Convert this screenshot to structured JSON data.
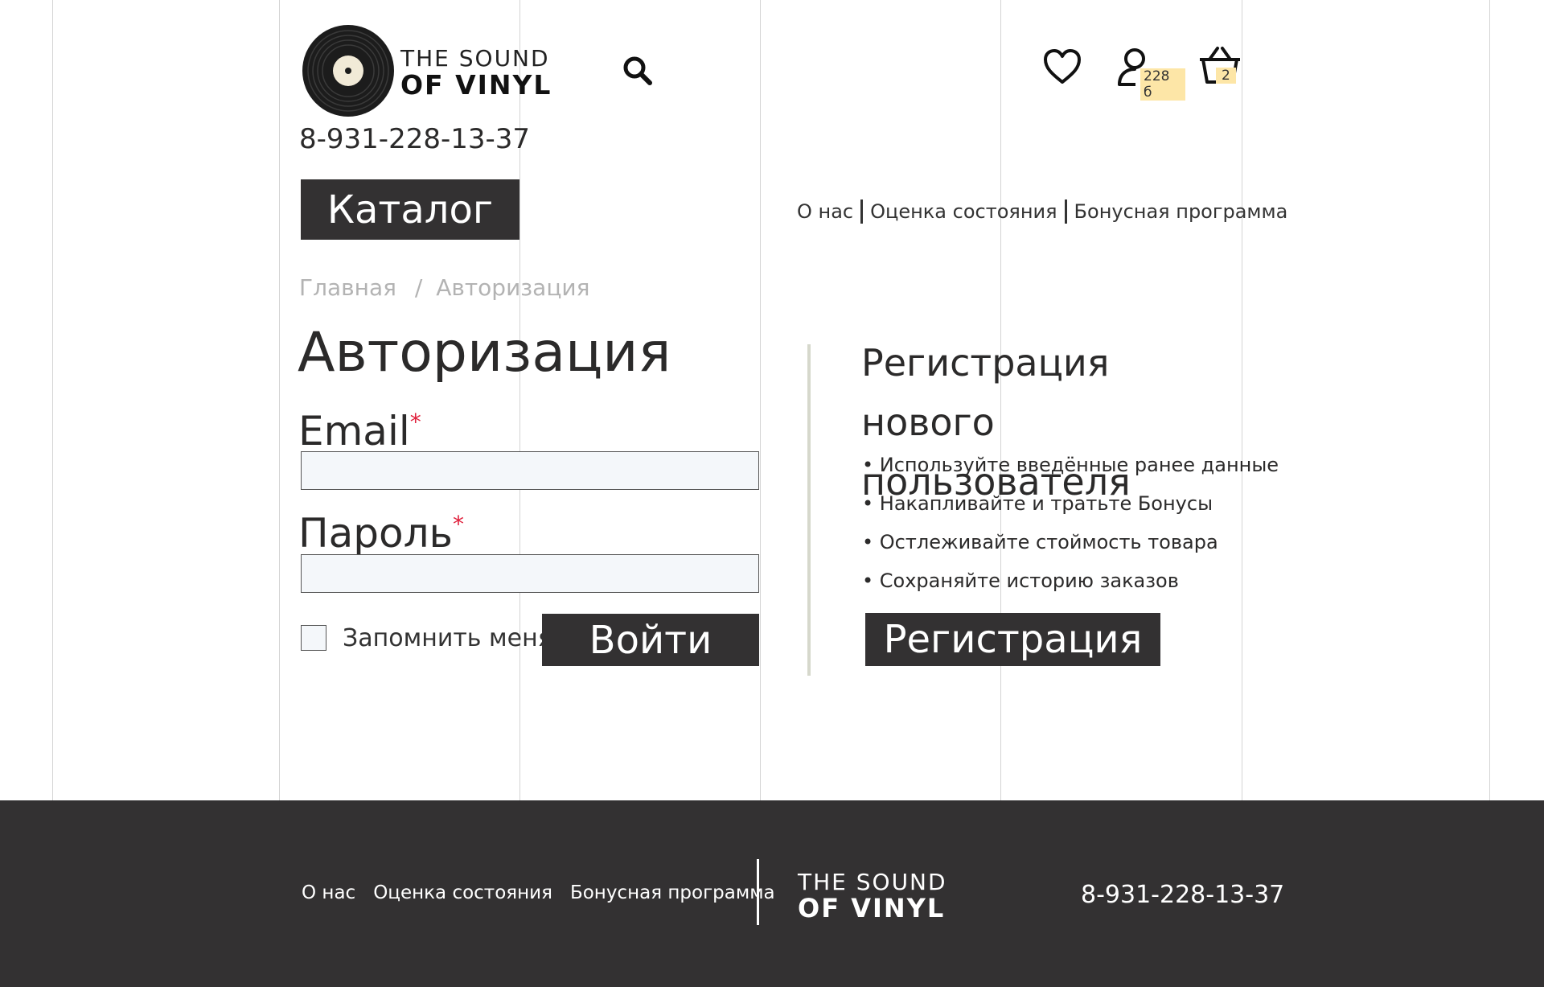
{
  "header": {
    "logo": {
      "line1": "THE SOUND",
      "line2": "OF VINYL"
    },
    "phone": "8-931-228-13-37",
    "catalog_label": "Каталог",
    "bonus_badge": "228 б",
    "cart_count": "2",
    "icons": [
      "vinyl-record-icon",
      "search-icon",
      "heart-icon",
      "user-icon",
      "cart-icon"
    ]
  },
  "topnav": [
    "О нас",
    "Оценка состояния",
    "Бонусная программа"
  ],
  "breadcrumb": {
    "home": "Главная",
    "separator": "/",
    "current": "Авторизация"
  },
  "login": {
    "title": "Авторизация",
    "email_label": "Email",
    "password_label": "Пароль",
    "required_mark": "*",
    "email_value": "",
    "password_value": "",
    "remember_label": "Запомнить меня",
    "remember_checked": false,
    "submit_label": "Войти"
  },
  "register": {
    "title": "Регистрация нового пользователя",
    "benefits": [
      "• Используйте введённые ранее данные",
      "• Накапливайте и тратьте Бонусы",
      "• Остлеживайте стоймость товара",
      "• Сохраняйте историю заказов"
    ],
    "button_label": "Регистрация"
  },
  "footer": {
    "nav": [
      "О нас",
      "Оценка состояния",
      "Бонусная программа"
    ],
    "logo": {
      "line1": "THE SOUND",
      "line2": "OF VINYL"
    },
    "phone": "8-931-228-13-37"
  },
  "colors": {
    "dark": "#333132",
    "badge": "#fde6a7",
    "required": "#e0213d",
    "input_bg": "#f4f7fa",
    "muted": "#b3b3b3"
  }
}
